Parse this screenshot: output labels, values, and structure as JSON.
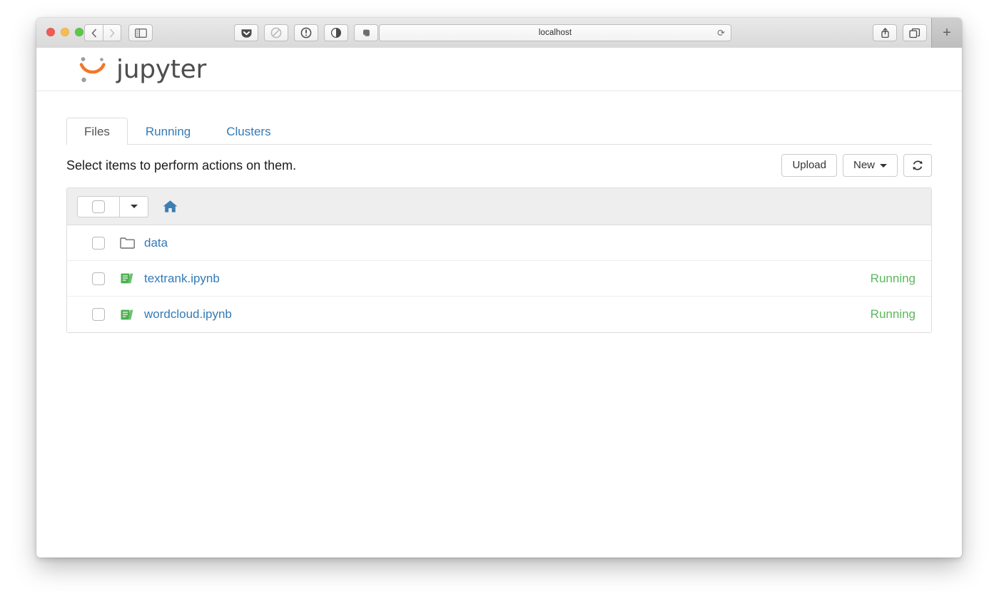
{
  "browser": {
    "url_text": "localhost",
    "back_icon": "chevron-left-icon",
    "forward_icon": "chevron-right-icon",
    "sidebar_icon": "sidebar-toggle-icon",
    "reload_icon": "reload-icon",
    "share_icon": "share-icon",
    "tabs_overview_icon": "tab-overview-icon",
    "new_tab_label": "+",
    "extensions": [
      {
        "name": "pocket-icon"
      },
      {
        "name": "adblock-icon"
      },
      {
        "name": "info-circle-icon"
      },
      {
        "name": "ghostery-icon"
      },
      {
        "name": "evernote-icon"
      }
    ]
  },
  "jupyter": {
    "logo_text": "jupyter",
    "logo_icon": "jupyter-logo-icon",
    "accent_orange": "#f37726",
    "accent_gray": "#767677",
    "link_blue": "#337ab7",
    "running_green": "#5cb85c",
    "tabs": [
      {
        "label": "Files",
        "active": true
      },
      {
        "label": "Running",
        "active": false
      },
      {
        "label": "Clusters",
        "active": false
      }
    ],
    "action_bar": {
      "note": "Select items to perform actions on them.",
      "upload_label": "Upload",
      "new_label": "New",
      "refresh_icon": "refresh-icon"
    },
    "file_list": {
      "select_all_icon": "select-all-checkbox",
      "select_dropdown_icon": "caret-down-icon",
      "breadcrumb_icon": "home-icon",
      "rows": [
        {
          "name": "data",
          "icon": "folder-icon",
          "type": "folder",
          "status": ""
        },
        {
          "name": "textrank.ipynb",
          "icon": "notebook-icon",
          "type": "notebook",
          "status": "Running"
        },
        {
          "name": "wordcloud.ipynb",
          "icon": "notebook-icon",
          "type": "notebook",
          "status": "Running"
        }
      ]
    }
  }
}
